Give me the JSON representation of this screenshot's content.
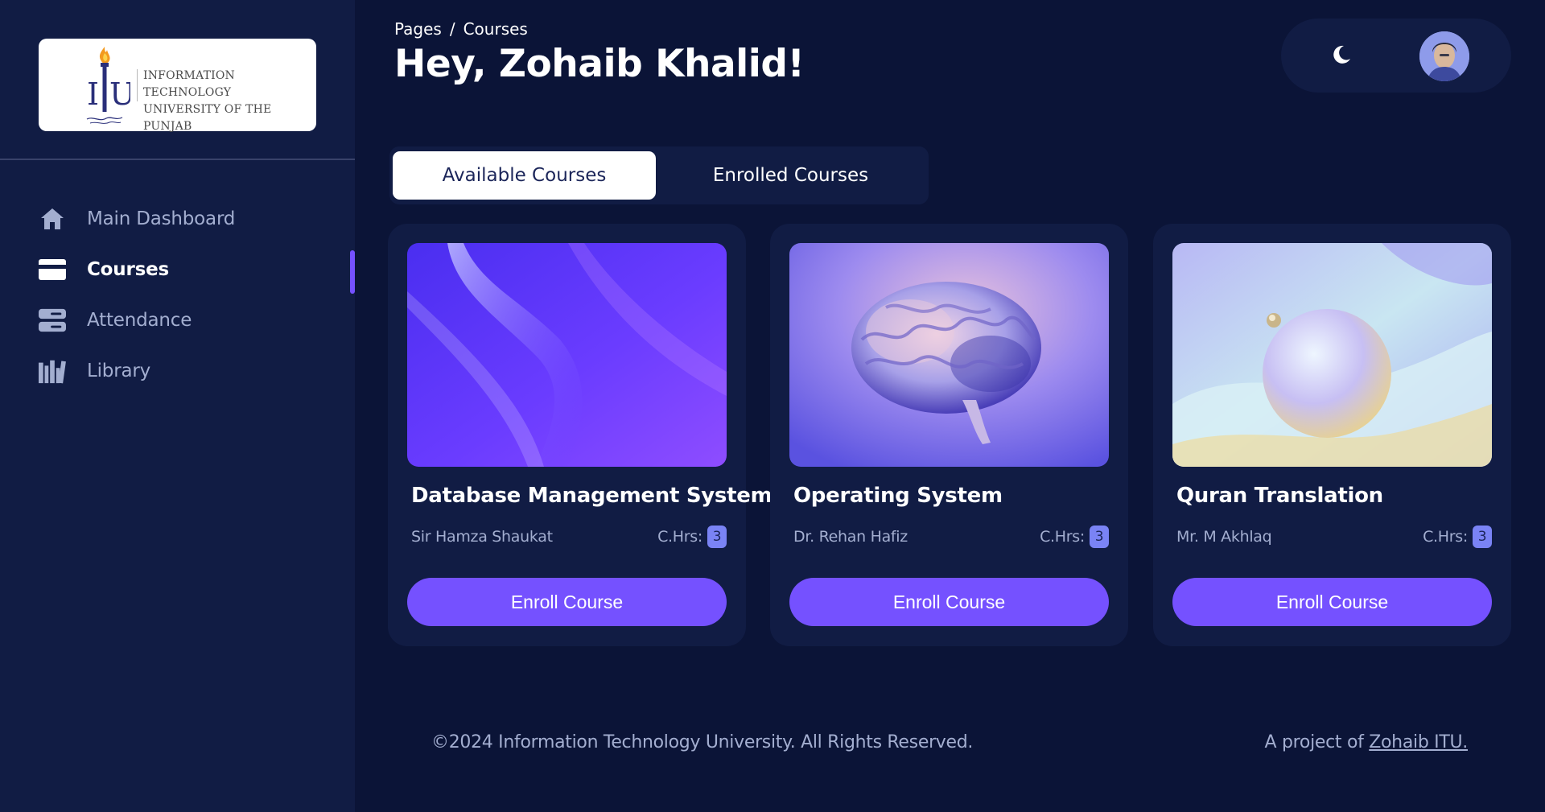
{
  "sidebar": {
    "logo": {
      "line1": "INFORMATION TECHNOLOGY",
      "line2": "UNIVERSITY OF THE PUNJAB",
      "mark": "ITU"
    },
    "items": [
      {
        "label": "Main Dashboard",
        "icon": "home-icon",
        "active": false
      },
      {
        "label": "Courses",
        "icon": "credit-card-icon",
        "active": true
      },
      {
        "label": "Attendance",
        "icon": "server-icon",
        "active": false
      },
      {
        "label": "Library",
        "icon": "books-icon",
        "active": false
      }
    ]
  },
  "header": {
    "breadcrumb": {
      "root": "Pages",
      "separator": "/",
      "current": "Courses"
    },
    "title": "Hey, Zohaib Khalid!"
  },
  "topbar": {
    "theme_icon": "moon-icon",
    "avatar_icon": "user-avatar"
  },
  "tabs": [
    {
      "label": "Available Courses",
      "active": true
    },
    {
      "label": "Enrolled Courses",
      "active": false
    }
  ],
  "courses": [
    {
      "title": "Database Management System",
      "instructor": "Sir Hamza Shaukat",
      "chrs_label": "C.Hrs:",
      "credit_hours": "3",
      "button": "Enroll Course"
    },
    {
      "title": "Operating System",
      "instructor": "Dr. Rehan Hafiz",
      "chrs_label": "C.Hrs:",
      "credit_hours": "3",
      "button": "Enroll Course"
    },
    {
      "title": "Quran Translation",
      "instructor": "Mr. M Akhlaq",
      "chrs_label": "C.Hrs:",
      "credit_hours": "3",
      "button": "Enroll Course"
    }
  ],
  "footer": {
    "copyright": "©2024 Information Technology University. All Rights Reserved.",
    "project_prefix": "A project of",
    "project_link": "Zohaib ITU."
  },
  "colors": {
    "background": "#0b1437",
    "panel": "#111c44",
    "accent": "#7551ff",
    "muted_text": "#a3aed0"
  }
}
